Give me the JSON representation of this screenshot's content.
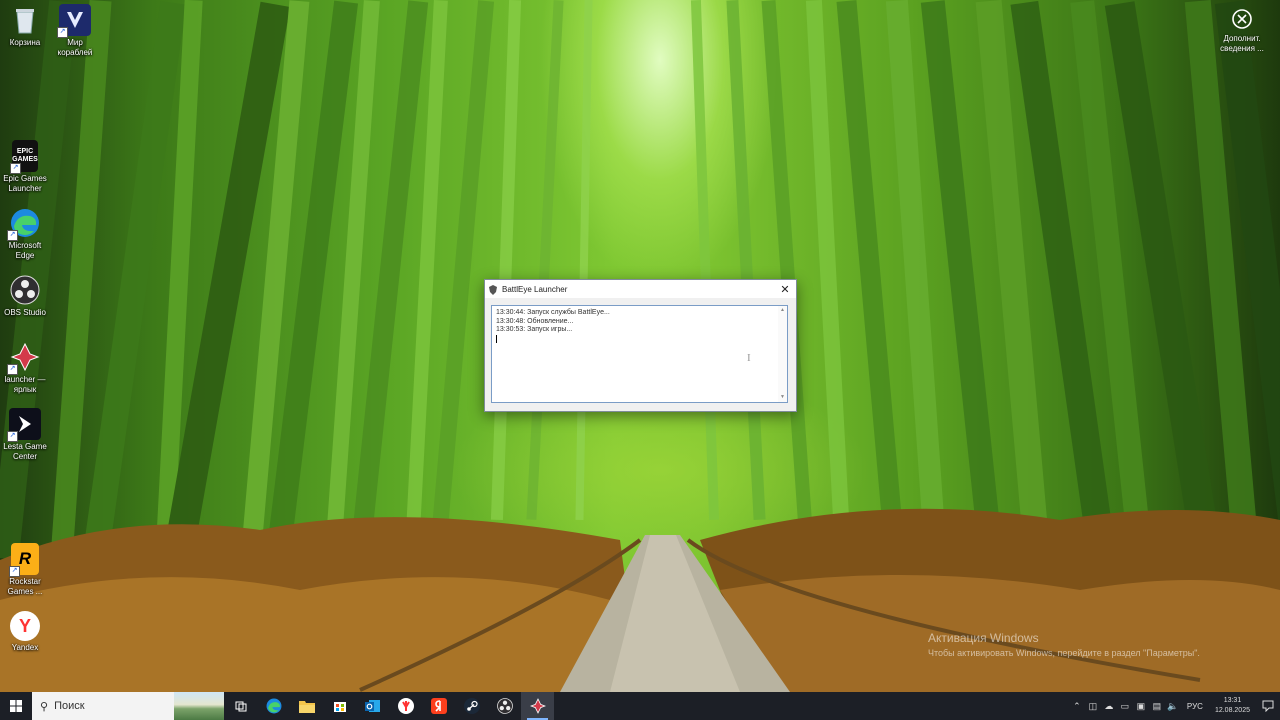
{
  "desktop": {
    "icons": [
      {
        "label": "Корзина"
      },
      {
        "label": "Мир кораблей"
      },
      {
        "label": "Epic Games Launcher",
        "glyph": "EPIC GAMES"
      },
      {
        "label": "Microsoft Edge"
      },
      {
        "label": "OBS Studio"
      },
      {
        "label": "launcher — ярлык"
      },
      {
        "label": "Lesta Game Center"
      },
      {
        "label": "Rockstar Games ...",
        "glyph": "R"
      },
      {
        "label": "Yandex",
        "glyph": "Y"
      }
    ],
    "extra_icon": {
      "label": "Дополнит. сведения ..."
    }
  },
  "battleye_window": {
    "title": "BattlEye Launcher",
    "close_glyph": "✕",
    "log_lines": [
      "13:30:44: Запуск службы BattlEye...",
      "13:30:48: Обновление...",
      "13:30:53: Запуск игры..."
    ]
  },
  "activation": {
    "title": "Активация Windows",
    "subtitle": "Чтобы активировать Windows, перейдите в раздел \"Параметры\"."
  },
  "taskbar": {
    "search_placeholder": "Поиск",
    "language": "РУС",
    "time": "13:31",
    "date": "12.08.2025"
  },
  "colors": {
    "taskbar_bg": "#1c1f26",
    "accent": "#7fb6ff"
  }
}
